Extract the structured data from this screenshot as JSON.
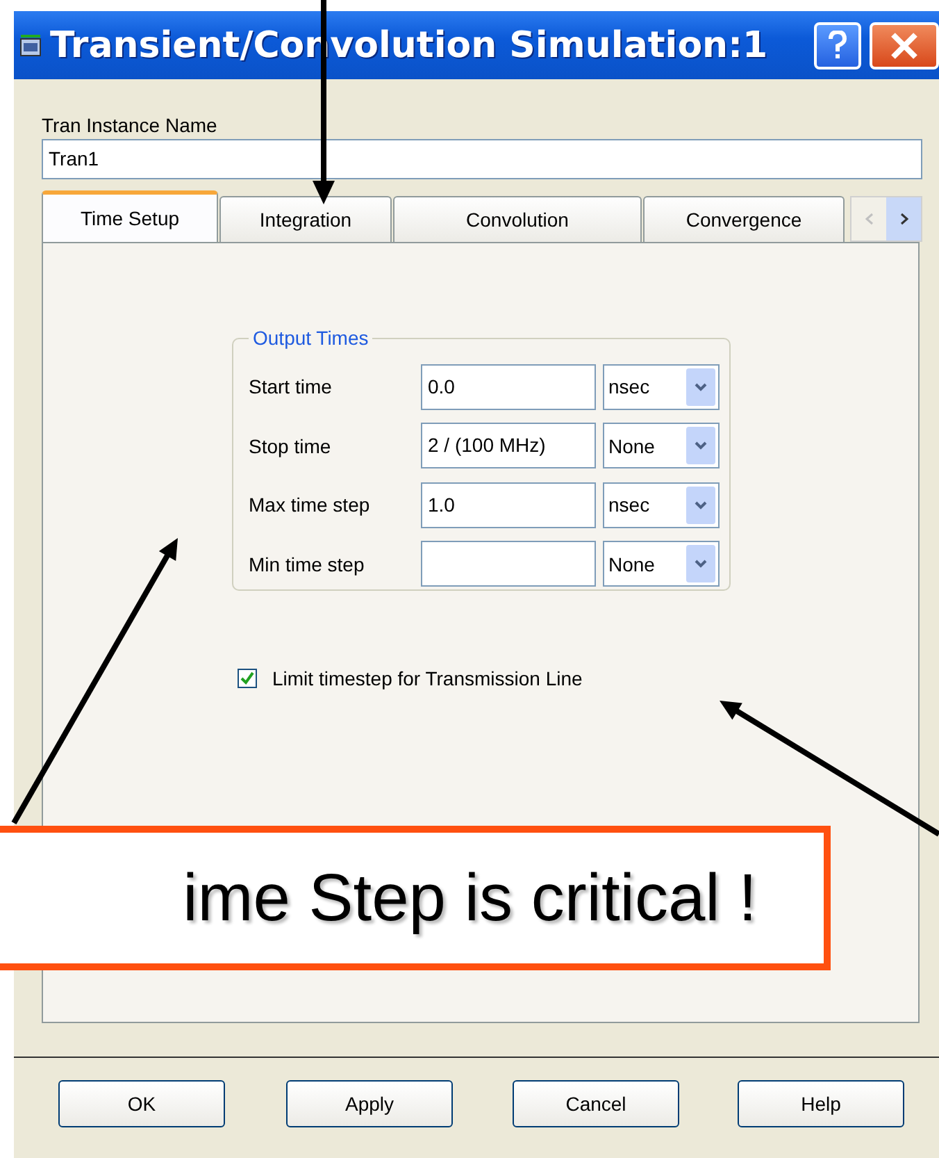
{
  "window": {
    "title": "Transient/Convolution Simulation:1"
  },
  "instance": {
    "label": "Tran Instance Name",
    "value": "Tran1"
  },
  "tabs": [
    {
      "label": "Time Setup",
      "selected": true
    },
    {
      "label": "Integration",
      "selected": false
    },
    {
      "label": "Convolution",
      "selected": false
    },
    {
      "label": "Convergence",
      "selected": false
    }
  ],
  "group": {
    "title": "Output Times",
    "rows": [
      {
        "label": "Start time",
        "value": "0.0",
        "unit": "nsec"
      },
      {
        "label": "Stop time",
        "value": "2 / (100 MHz)",
        "unit": "None"
      },
      {
        "label": "Max time step",
        "value": "1.0",
        "unit": "nsec"
      },
      {
        "label": "Min time step",
        "unit": "None"
      }
    ]
  },
  "checkbox": {
    "label": "Limit timestep for Transmission Line",
    "checked": true
  },
  "buttons": [
    "OK",
    "Apply",
    "Cancel",
    "Help"
  ],
  "callout": {
    "text": "ime Step is critical !"
  }
}
